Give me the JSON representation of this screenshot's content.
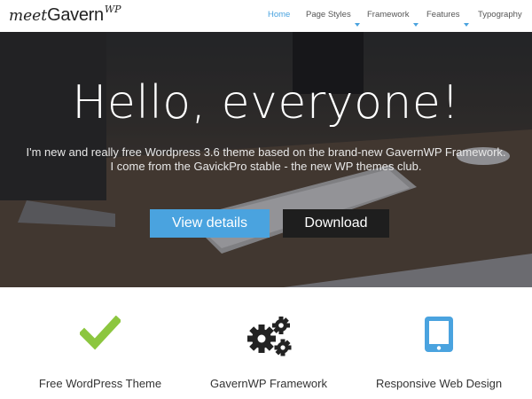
{
  "logo": {
    "prefix": "meet",
    "name": "Gavern",
    "suffix": "WP"
  },
  "nav": {
    "items": [
      {
        "label": "Home",
        "active": true,
        "has_dropdown": false
      },
      {
        "label": "Page Styles",
        "active": false,
        "has_dropdown": true
      },
      {
        "label": "Framework",
        "active": false,
        "has_dropdown": true
      },
      {
        "label": "Features",
        "active": false,
        "has_dropdown": true
      },
      {
        "label": "Typography",
        "active": false,
        "has_dropdown": false
      }
    ]
  },
  "hero": {
    "title": "Hello, everyone!",
    "line1": "I'm new and really free Wordpress 3.6 theme based on the brand-new GavernWP Framework.",
    "line2": "I come from the GavickPro stable - the new WP themes club.",
    "buttons": {
      "details": "View details",
      "download": "Download"
    }
  },
  "features": [
    {
      "label": "Free WordPress Theme",
      "icon": "checkmark-icon"
    },
    {
      "label": "GavernWP Framework",
      "icon": "gears-icon"
    },
    {
      "label": "Responsive Web Design",
      "icon": "tablet-icon"
    }
  ],
  "colors": {
    "accent": "#4aa3df",
    "check_green": "#8cc63f",
    "dark_button": "#1e1e1e",
    "gear_dark": "#222222"
  }
}
